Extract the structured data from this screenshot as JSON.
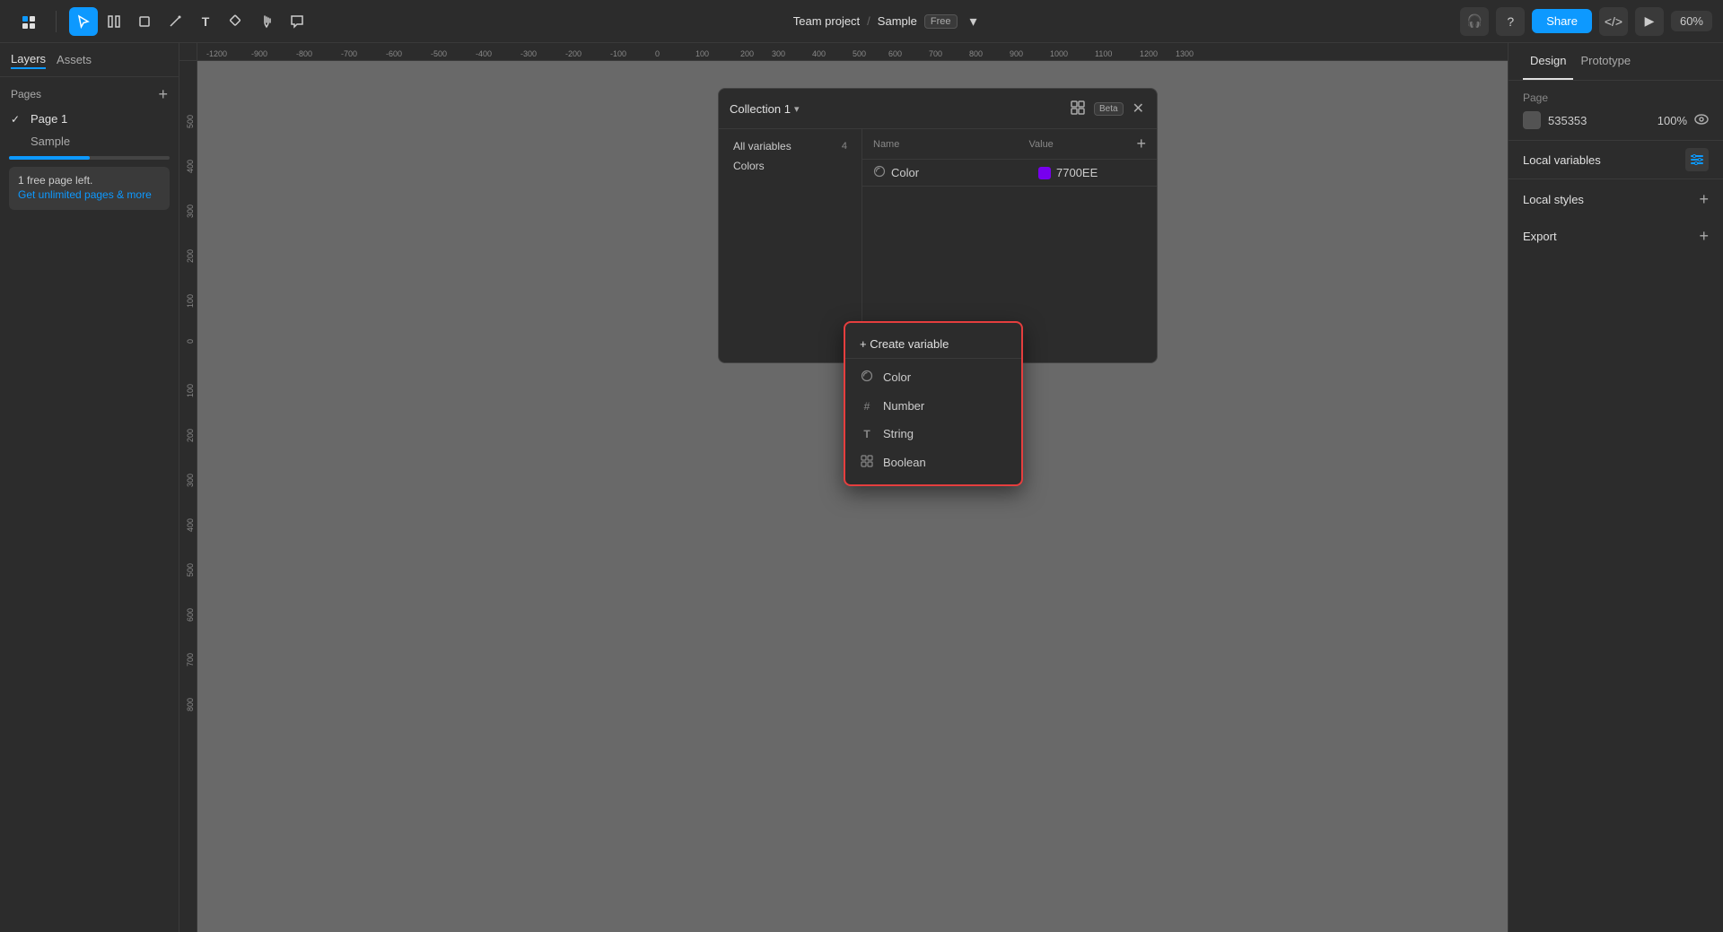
{
  "app": {
    "project": "Team project",
    "separator": "/",
    "file_name": "Sample",
    "free_badge": "Free",
    "zoom": "60%"
  },
  "toolbar": {
    "share_label": "Share",
    "tools": [
      "▾",
      "↖",
      "⬚",
      "◇",
      "T",
      "⊞",
      "✋",
      "💬"
    ],
    "tool_names": [
      "menu",
      "select",
      "frame",
      "shape",
      "text",
      "components",
      "hand",
      "comment"
    ]
  },
  "left_panel": {
    "tabs": [
      {
        "id": "layers",
        "label": "Layers"
      },
      {
        "id": "assets",
        "label": "Assets"
      }
    ],
    "active_tab": "layers",
    "pages_title": "Pages",
    "add_page_tooltip": "Add page",
    "pages": [
      {
        "id": "page1",
        "label": "Page 1",
        "active": true
      },
      {
        "id": "sample",
        "label": "Sample",
        "active": false
      }
    ],
    "free_page_text": "1 free page left.",
    "free_page_link": "Get unlimited pages & more"
  },
  "variables_panel": {
    "collection_name": "Collection 1",
    "beta_label": "Beta",
    "all_variables_label": "All variables",
    "all_variables_count": "4",
    "colors_label": "Colors",
    "table_headers": {
      "name": "Name",
      "value": "Value"
    },
    "rows": [
      {
        "icon": "🎨",
        "name": "Color",
        "value": "7700EE",
        "color": "#7700ee"
      }
    ]
  },
  "dropdown_menu": {
    "create_label": "+ Create variable",
    "items": [
      {
        "id": "color",
        "icon": "🎨",
        "label": "Color"
      },
      {
        "id": "number",
        "icon": "#",
        "label": "Number"
      },
      {
        "id": "string",
        "icon": "T",
        "label": "String"
      },
      {
        "id": "boolean",
        "icon": "⊞",
        "label": "Boolean"
      }
    ]
  },
  "right_panel": {
    "tabs": [
      {
        "id": "design",
        "label": "Design",
        "active": true
      },
      {
        "id": "prototype",
        "label": "Prototype",
        "active": false
      }
    ],
    "page_section": {
      "title": "Page",
      "color_value": "535353",
      "opacity": "100%"
    },
    "local_variables": {
      "label": "Local variables",
      "icon": "≡"
    },
    "local_styles": {
      "label": "Local styles"
    },
    "export": {
      "label": "Export"
    }
  }
}
